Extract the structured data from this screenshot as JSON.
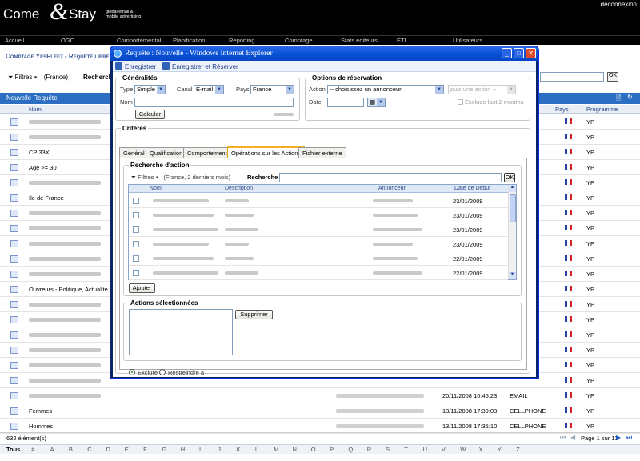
{
  "header": {
    "logo_main": "Come",
    "logo_amp": "&",
    "logo_stay": "Stay",
    "logo_tag": "global email & mobile advertising",
    "logout": "déconnexion"
  },
  "nav": [
    "Accueil",
    "OGC",
    "Comportemental",
    "Planification",
    "Reporting",
    "Comptage",
    "Stats éditeurs",
    "ETL",
    "Utilisateurs"
  ],
  "page": {
    "breadcrumb": "Comptage YesPleez - Requête libre",
    "filter_label": "Filtres",
    "filter_value": "(France)",
    "search_label": "Recherche",
    "ok": "OK",
    "grid_title": "Nouvelle Requête",
    "columns": {
      "name": "Nom",
      "country": "Pays",
      "program": "Programme"
    },
    "rows": [
      {
        "name": "",
        "date": "",
        "type": "",
        "prog": "YP"
      },
      {
        "name": "",
        "date": "",
        "type": "",
        "prog": "YP"
      },
      {
        "name": "CP 33X",
        "date": "",
        "type": "",
        "prog": "YP"
      },
      {
        "name": "Age >= 30",
        "date": "",
        "type": "",
        "prog": "YP"
      },
      {
        "name": "",
        "date": "",
        "type": "",
        "prog": "YP"
      },
      {
        "name": "Ile de France",
        "date": "",
        "type": "",
        "prog": "YP"
      },
      {
        "name": "",
        "date": "",
        "type": "",
        "prog": "YP"
      },
      {
        "name": "",
        "date": "",
        "type": "",
        "prog": "YP"
      },
      {
        "name": "",
        "date": "",
        "type": "",
        "prog": "YP"
      },
      {
        "name": "",
        "date": "",
        "type": "",
        "prog": "YP"
      },
      {
        "name": "",
        "date": "",
        "type": "",
        "prog": "YP"
      },
      {
        "name": "Ouvreurs - Politique, Actualite so",
        "date": "",
        "type": "",
        "prog": "YP"
      },
      {
        "name": "",
        "date": "",
        "type": "",
        "prog": "YP"
      },
      {
        "name": "",
        "date": "",
        "type": "",
        "prog": "YP"
      },
      {
        "name": "",
        "date": "",
        "type": "",
        "prog": "YP"
      },
      {
        "name": "",
        "date": "",
        "type": "",
        "prog": "YP"
      },
      {
        "name": "",
        "date": "",
        "type": "",
        "prog": "YP"
      },
      {
        "name": "",
        "date": "",
        "type": "",
        "prog": "YP"
      },
      {
        "name": "",
        "date": "20/11/2008 10:45:23",
        "type": "EMAIL",
        "prog": "YP"
      },
      {
        "name": "Femmes",
        "date": "13/11/2008 17:39:03",
        "type": "CELLPHONE",
        "prog": "YP"
      },
      {
        "name": "Hommes",
        "date": "13/11/2008 17:35:10",
        "type": "CELLPHONE",
        "prog": "YP"
      }
    ],
    "count": "632 élément(s)",
    "pager": "Page 1 sur 13",
    "alphabet": [
      "Tous",
      "#",
      "A",
      "B",
      "C",
      "D",
      "E",
      "F",
      "G",
      "H",
      "I",
      "J",
      "K",
      "L",
      "M",
      "N",
      "O",
      "P",
      "Q",
      "R",
      "S",
      "T",
      "U",
      "V",
      "W",
      "X",
      "Y",
      "Z"
    ]
  },
  "dialog": {
    "title": "Requête : Nouvelle - Windows Internet Explorer",
    "save": "Enregistrer",
    "save_reserve": "Enregistrer et Réserver",
    "general": {
      "legend": "Généralités",
      "type_label": "Type",
      "type_value": "Simple",
      "canal_label": "Canal",
      "canal_value": "E-mail",
      "pays_label": "Pays",
      "pays_value": "France",
      "nom_label": "Nom",
      "calc": "Calculer"
    },
    "reservation": {
      "legend": "Options de réservation",
      "action_label": "Action",
      "action_value": "-- choisissez un annonceur,",
      "action2": "puis une action --",
      "date_label": "Date",
      "exclude": "Exclude last 2 months"
    },
    "criteria": {
      "legend": "Critères",
      "tabs": [
        "Général",
        "Qualification",
        "Comportement",
        "Opérations sur les Actions",
        "Fichier externe"
      ],
      "search_legend": "Recherche d'action",
      "filter_label": "Filtres",
      "filter_value": "(France, 2 derniers mois)",
      "search_label": "Recherche",
      "ok": "OK",
      "columns": {
        "name": "Nom",
        "desc": "Description",
        "adv": "Annonceur",
        "date": "Date de Début"
      },
      "rows": [
        "23/01/2009",
        "23/01/2009",
        "23/01/2009",
        "23/01/2009",
        "22/01/2009",
        "22/01/2009"
      ],
      "add": "Ajouter",
      "selected_legend": "Actions sélectionnées",
      "remove": "Supprimer",
      "exclude": "Exclure",
      "restrict": "Restreindre à"
    }
  }
}
